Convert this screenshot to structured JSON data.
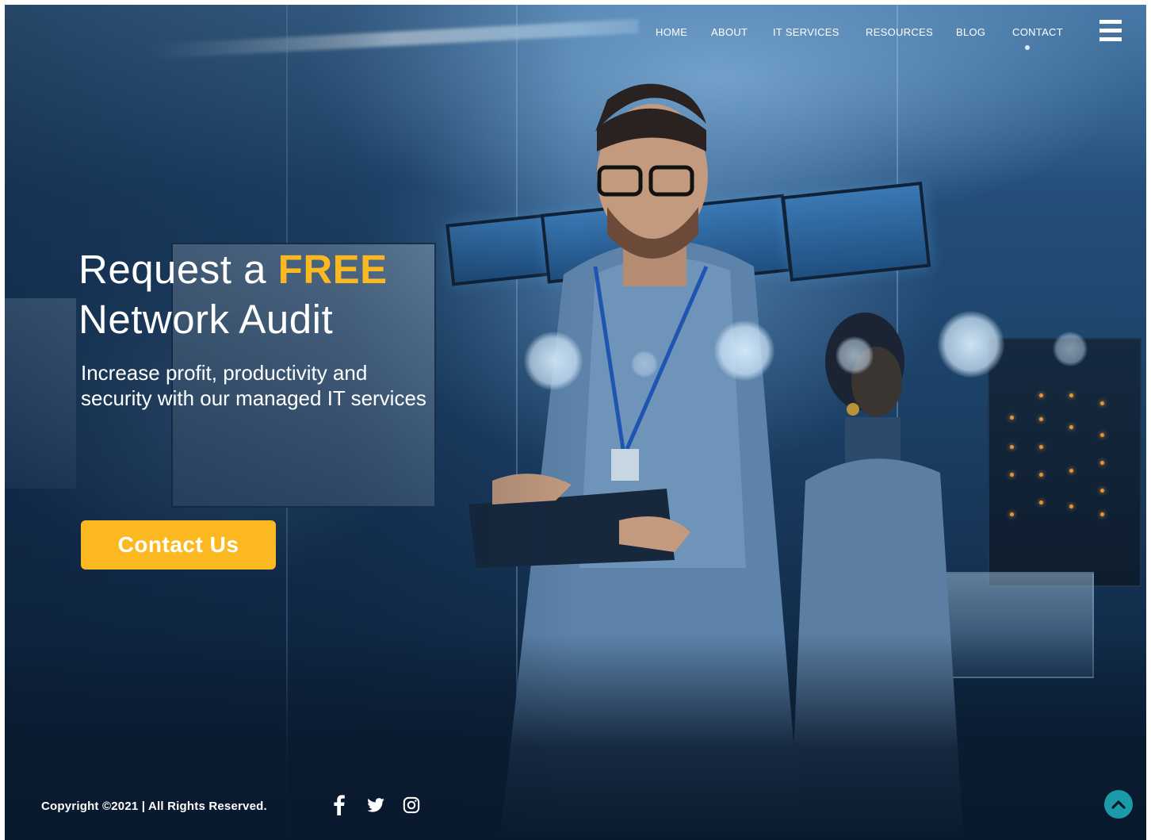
{
  "nav": {
    "items": [
      {
        "label": "HOME"
      },
      {
        "label": "ABOUT"
      },
      {
        "label": "IT SERVICES"
      },
      {
        "label": "RESOURCES"
      },
      {
        "label": "BLOG"
      },
      {
        "label": "CONTACT"
      }
    ],
    "menu_icon": "hamburger-menu-icon"
  },
  "hero": {
    "title_part1": "Request a ",
    "title_accent": "FREE",
    "title_part2": "Network Audit",
    "subtitle": "Increase profit, productivity and security with our managed IT services",
    "cta_label": "Contact Us"
  },
  "footer": {
    "copyright": "Copyright ©2021  |  All Rights Reserved.",
    "social_icons": [
      "facebook-icon",
      "twitter-icon",
      "instagram-icon"
    ],
    "back_to_top_icon": "chevron-up-icon"
  },
  "colors": {
    "accent": "#fbb820",
    "text": "#ffffff",
    "back_to_top": "#1b9aa8",
    "background": "#0b1e33"
  }
}
